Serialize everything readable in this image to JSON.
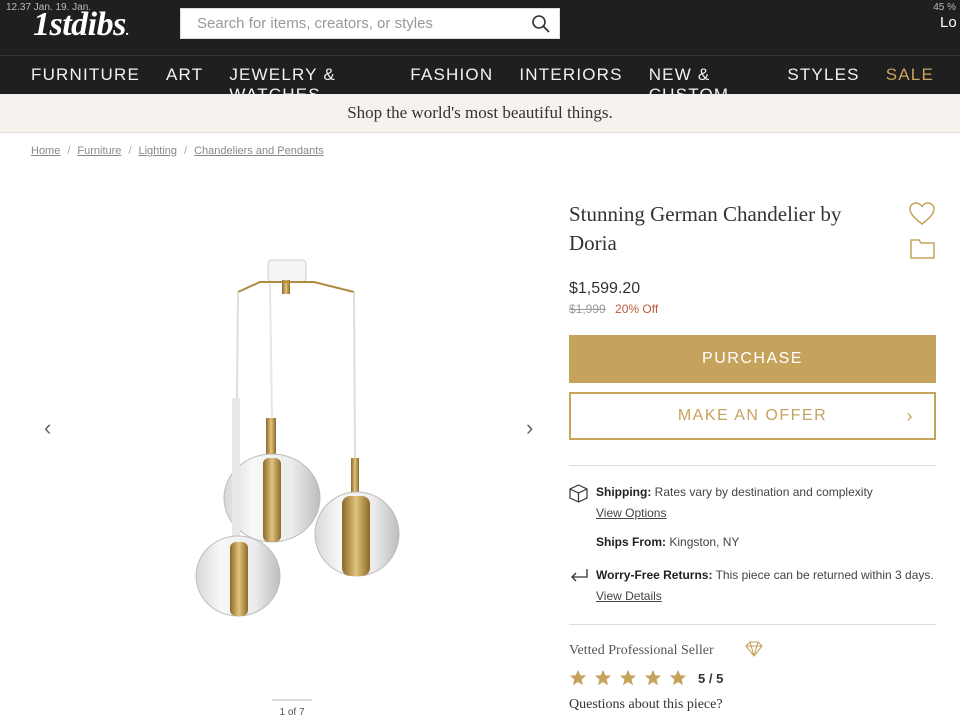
{
  "status": {
    "time_date": "12.37  Jan. 19. Jan.",
    "battery": "45 %"
  },
  "header": {
    "logo": "1stdibs",
    "logo_dot": ".",
    "search_placeholder": "Search for items, creators, or styles",
    "login": "Lo"
  },
  "nav": {
    "items": [
      "FURNITURE",
      "ART",
      "JEWELRY & WATCHES",
      "FASHION",
      "INTERIORS",
      "NEW & CUSTOM",
      "STYLES",
      "SALE"
    ]
  },
  "banner": {
    "text": "Shop the world's most beautiful things."
  },
  "breadcrumb": {
    "items": [
      "Home",
      "Furniture",
      "Lighting",
      "Chandeliers and Pendants"
    ],
    "sep": "/"
  },
  "gallery": {
    "prev": "‹",
    "next": "›",
    "page": "1 of 7"
  },
  "product": {
    "title": "Stunning German Chandelier by Doria",
    "price": "$1,599.20",
    "old_price": "$1,999",
    "discount": "20% Off",
    "purchase_label": "PURCHASE",
    "offer_label": "MAKE AN OFFER",
    "offer_chevron": "›"
  },
  "details": {
    "shipping_label": "Shipping:",
    "shipping_text": " Rates vary by destination and complexity",
    "shipping_link": "View Options",
    "ships_from_label": "Ships From:",
    "ships_from_text": " Kingston, NY",
    "returns_label": "Worry-Free Returns:",
    "returns_text": " This piece can be returned within 3 days. ",
    "returns_link": "View Details"
  },
  "seller": {
    "vetted": "Vetted Professional Seller",
    "rating": "5 / 5",
    "stars": 5,
    "questions": "Questions about this piece?"
  },
  "colors": {
    "gold": "#c6a35d",
    "header_bg": "#1f1f1f",
    "discount": "#c0573b",
    "banner_bg": "#f6f2ee"
  }
}
